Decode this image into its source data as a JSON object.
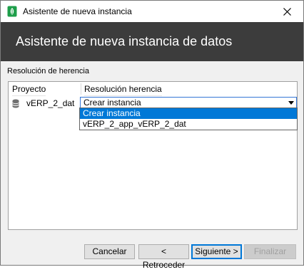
{
  "window": {
    "title": "Asistente de nueva instancia",
    "icon": "app-leaf-icon",
    "close_icon": "close-icon"
  },
  "header": {
    "title": "Asistente de nueva instancia de datos"
  },
  "section": {
    "label": "Resolución de herencia"
  },
  "table": {
    "columns": [
      "Proyecto",
      "Resolución herencia"
    ],
    "rows": [
      {
        "project": "vERP_2_dat",
        "icon": "database-icon",
        "resolution": "Crear instancia"
      }
    ]
  },
  "dropdown": {
    "options": [
      "Crear instancia",
      "vERP_2_app_vERP_2_dat"
    ],
    "selected_index": 0
  },
  "buttons": {
    "cancel": "Cancelar",
    "back": "< Retroceder",
    "next": "Siguiente >",
    "finish": "Finalizar"
  },
  "colors": {
    "header_bg": "#3c3c3c",
    "accent": "#0078d7",
    "icon_green": "#1e9e4a"
  }
}
